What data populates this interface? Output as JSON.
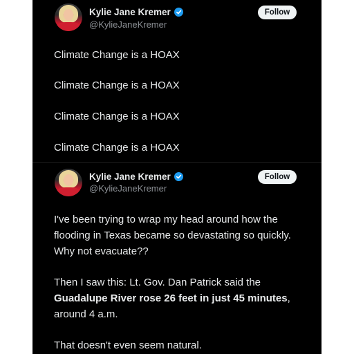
{
  "tweets": [
    {
      "author": {
        "name": "Kylie Jane Kremer",
        "handle": "@KylieJaneKremer",
        "verified_icon": "verified-badge-icon",
        "verified_color": "#1d9bf0"
      },
      "follow_label": "Follow",
      "lines": [
        "Climate Change is a HOAX",
        "Climate Change is a HOAX",
        "Climate Change is a HOAX",
        "Climate Change is a HOAX"
      ]
    },
    {
      "author": {
        "name": "Kylie Jane Kremer",
        "handle": "@KylieJaneKremer",
        "verified_icon": "verified-badge-icon",
        "verified_color": "#1d9bf0"
      },
      "follow_label": "Follow",
      "paragraph1": "I've been trying to wrap my head around how the flooding in Texas became so devastating so quickly. Why not evacuate??",
      "paragraph2_prefix": "Then I saw this: Lt. Gov. Dan Patrick said the",
      "paragraph2_bold": "Guadalupe River rose 26 feet in just 45 minutes",
      "paragraph2_suffix": ", around 4 a.m.",
      "paragraph3": "That doesn't even seem natural."
    }
  ],
  "theme": {
    "background": "#000000",
    "text": "#e7e9ea",
    "secondary_text": "#8b8f94",
    "follow_button_bg": "#eff3f4"
  }
}
